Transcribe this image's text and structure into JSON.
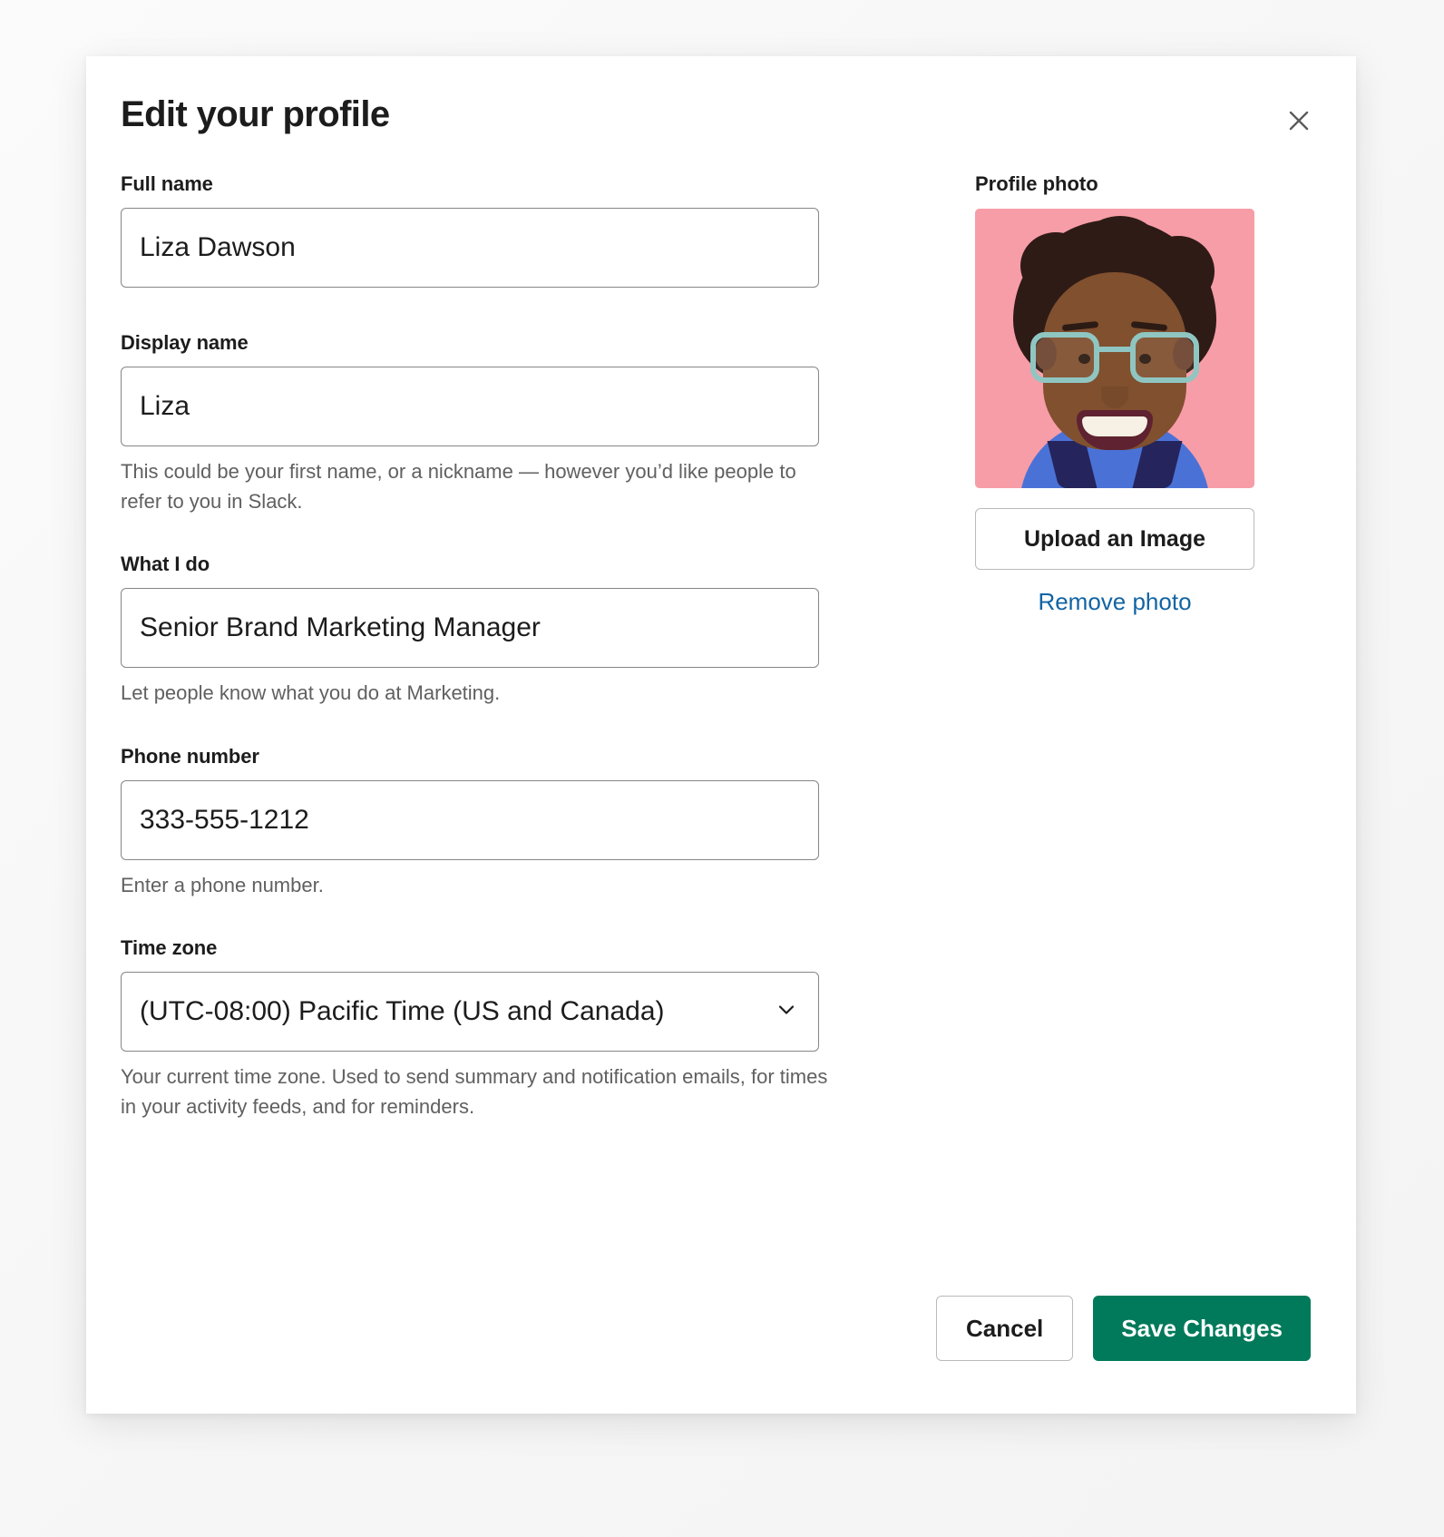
{
  "dialog": {
    "title": "Edit your profile",
    "close_icon": "close-icon"
  },
  "form": {
    "full_name": {
      "label": "Full name",
      "value": "Liza Dawson",
      "placeholder": ""
    },
    "display_name": {
      "label": "Display name",
      "value": "Liza",
      "placeholder": "",
      "helper": "This could be your first name, or a nickname — however you’d like people to refer to you in Slack."
    },
    "what_i_do": {
      "label": "What I do",
      "value": "Senior Brand Marketing Manager",
      "placeholder": "",
      "helper": "Let people know what you do at Marketing."
    },
    "phone_number": {
      "label": "Phone number",
      "value": "333-555-1212",
      "placeholder": "",
      "helper": "Enter a phone number."
    },
    "time_zone": {
      "label": "Time zone",
      "value": "(UTC-08:00) Pacific Time (US and Canada)",
      "helper": "Your current time zone. Used to send summary and notification emails, for times in your activity feeds, and for reminders.",
      "chevron_icon": "chevron-down-icon"
    }
  },
  "profile_photo": {
    "label": "Profile photo",
    "upload_label": "Upload an Image",
    "remove_label": "Remove photo",
    "avatar_alt": "profile-photo-avatar"
  },
  "footer": {
    "cancel_label": "Cancel",
    "save_label": "Save Changes"
  },
  "colors": {
    "accent_green": "#007a5a",
    "link_blue": "#1264a3",
    "text_primary": "#1d1c1d",
    "text_secondary": "#616061",
    "border_gray": "#868686",
    "avatar_background": "#f79da7"
  }
}
